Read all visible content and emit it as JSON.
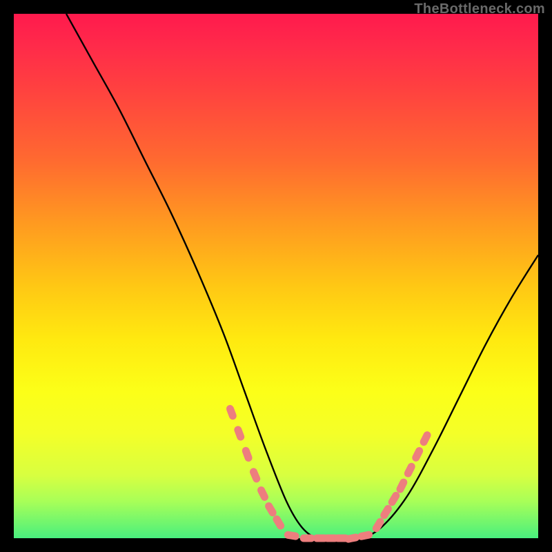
{
  "watermark": "TheBottleneck.com",
  "colors": {
    "background": "#000000",
    "curve": "#000000",
    "dot_fill": "#ed7e7e",
    "dot_stroke": "#c55",
    "gradient_stops": [
      "#ff1a4d",
      "#ff2a4a",
      "#ff4040",
      "#ff6a30",
      "#ff9a20",
      "#ffc814",
      "#ffe910",
      "#fcff18",
      "#f4ff28",
      "#d8ff40",
      "#a8ff58",
      "#49ef7e"
    ]
  },
  "chart_data": {
    "type": "line",
    "title": "",
    "xlabel": "",
    "ylabel": "",
    "xlim": [
      0,
      100
    ],
    "ylim": [
      0,
      100
    ],
    "series": [
      {
        "name": "bottleneck-curve",
        "x": [
          10,
          15,
          20,
          25,
          30,
          35,
          40,
          44,
          48,
          52,
          55,
          58,
          62,
          66,
          70,
          75,
          80,
          85,
          90,
          95,
          100
        ],
        "y": [
          100,
          91,
          82,
          72,
          62,
          51,
          39,
          28,
          17,
          7,
          2,
          0,
          0,
          0,
          2,
          8,
          17,
          27,
          37,
          46,
          54
        ]
      }
    ],
    "markers": [
      {
        "name": "left-slope-dots",
        "x": [
          41.5,
          43.0,
          44.5,
          46.0,
          47.5,
          49.0,
          50.5
        ],
        "y": [
          24.0,
          20.0,
          16.0,
          12.0,
          8.5,
          5.5,
          3.0
        ]
      },
      {
        "name": "bottom-dots",
        "x": [
          53.0,
          56.0,
          58.5,
          60.5,
          62.5,
          64.5,
          67.0
        ],
        "y": [
          0.5,
          0.0,
          0.0,
          0.0,
          0.0,
          0.0,
          0.5
        ]
      },
      {
        "name": "right-slope-dots",
        "x": [
          69.5,
          71.0,
          72.5,
          74.0,
          75.5,
          77.0,
          78.5
        ],
        "y": [
          2.5,
          5.0,
          7.5,
          10.0,
          13.0,
          16.0,
          19.0
        ]
      }
    ]
  }
}
